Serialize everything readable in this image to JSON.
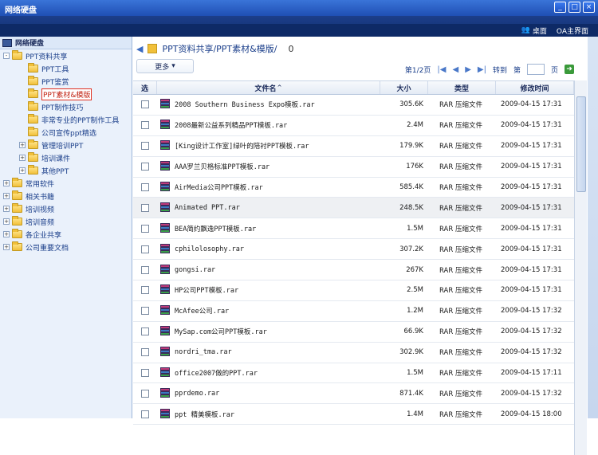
{
  "window": {
    "title": "网络硬盘",
    "controls": [
      "_",
      "□",
      "×"
    ]
  },
  "topbar": {
    "desktop": "桌面",
    "oa_home": "OA主界面"
  },
  "sidebar": {
    "header": "网络硬盘",
    "tree": [
      {
        "label": "PPT资料共享",
        "level": 0,
        "expander": "-"
      },
      {
        "label": "PPT工具",
        "level": 1,
        "expander": ""
      },
      {
        "label": "PPT鉴赏",
        "level": 1,
        "expander": ""
      },
      {
        "label": "PPT素材&模版",
        "level": 1,
        "expander": "",
        "selected": true
      },
      {
        "label": "PPT制作技巧",
        "level": 1,
        "expander": ""
      },
      {
        "label": "非常专业的PPT制作工具",
        "level": 1,
        "expander": ""
      },
      {
        "label": "公司宣传ppt精选",
        "level": 1,
        "expander": ""
      },
      {
        "label": "管理培训PPT",
        "level": 1,
        "expander": "+"
      },
      {
        "label": "培训课件",
        "level": 1,
        "expander": "+"
      },
      {
        "label": "其他PPT",
        "level": 1,
        "expander": "+"
      },
      {
        "label": "常用软件",
        "level": 0,
        "expander": "+"
      },
      {
        "label": "相关书籍",
        "level": 0,
        "expander": "+"
      },
      {
        "label": "培训视频",
        "level": 0,
        "expander": "+"
      },
      {
        "label": "培训音频",
        "level": 0,
        "expander": "+"
      },
      {
        "label": "各企业共享",
        "level": 0,
        "expander": "+"
      },
      {
        "label": "公司重要文档",
        "level": 0,
        "expander": "+"
      }
    ]
  },
  "main": {
    "breadcrumb": "PPT资料共享/PPT素材&模版/",
    "count": "0",
    "more": "更多",
    "pager": {
      "page_info": "第1/2页",
      "goto": "转到",
      "di": "第",
      "ye": "页",
      "input_value": ""
    },
    "columns": {
      "select": "选",
      "name": "文件名",
      "sort_indicator": "^",
      "size": "大小",
      "type": "类型",
      "mtime": "修改时间"
    },
    "rows": [
      {
        "name": "2008 Southern Business Expo模板.rar",
        "size": "305.6K",
        "type": "RAR 压缩文件",
        "mtime": "2009-04-15 17:31"
      },
      {
        "name": "2008最新公益系列精品PPT模板.rar",
        "size": "2.4M",
        "type": "RAR 压缩文件",
        "mtime": "2009-04-15 17:31"
      },
      {
        "name": "[King设计工作室]绿叶的陪衬PPT模板.rar",
        "size": "179.9K",
        "type": "RAR 压缩文件",
        "mtime": "2009-04-15 17:31"
      },
      {
        "name": "AAA罗兰贝格标准PPT模板.rar",
        "size": "176K",
        "type": "RAR 压缩文件",
        "mtime": "2009-04-15 17:31"
      },
      {
        "name": "AirMedia公司PPT模板.rar",
        "size": "585.4K",
        "type": "RAR 压缩文件",
        "mtime": "2009-04-15 17:31"
      },
      {
        "name": "Animated PPT.rar",
        "size": "248.5K",
        "type": "RAR 压缩文件",
        "mtime": "2009-04-15 17:31",
        "highlight": true
      },
      {
        "name": "BEA简约飘逸PPT模板.rar",
        "size": "1.5M",
        "type": "RAR 压缩文件",
        "mtime": "2009-04-15 17:31"
      },
      {
        "name": "cphilolosophy.rar",
        "size": "307.2K",
        "type": "RAR 压缩文件",
        "mtime": "2009-04-15 17:31"
      },
      {
        "name": "gongsi.rar",
        "size": "267K",
        "type": "RAR 压缩文件",
        "mtime": "2009-04-15 17:31"
      },
      {
        "name": "HP公司PPT模板.rar",
        "size": "2.5M",
        "type": "RAR 压缩文件",
        "mtime": "2009-04-15 17:31"
      },
      {
        "name": "McAfee公司.rar",
        "size": "1.2M",
        "type": "RAR 压缩文件",
        "mtime": "2009-04-15 17:32"
      },
      {
        "name": "MySap.com公司PPT模板.rar",
        "size": "66.9K",
        "type": "RAR 压缩文件",
        "mtime": "2009-04-15 17:32"
      },
      {
        "name": "nordri_tma.rar",
        "size": "302.9K",
        "type": "RAR 压缩文件",
        "mtime": "2009-04-15 17:32"
      },
      {
        "name": "office2007做的PPT.rar",
        "size": "1.5M",
        "type": "RAR 压缩文件",
        "mtime": "2009-04-15 17:11"
      },
      {
        "name": "pprdemo.rar",
        "size": "871.4K",
        "type": "RAR 压缩文件",
        "mtime": "2009-04-15 17:32"
      },
      {
        "name": "ppt 精美模板.rar",
        "size": "1.4M",
        "type": "RAR 压缩文件",
        "mtime": "2009-04-15 18:00"
      }
    ]
  }
}
